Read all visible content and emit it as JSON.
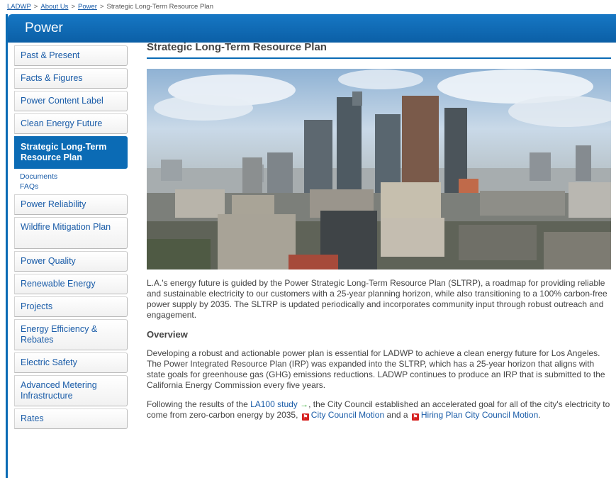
{
  "breadcrumb": {
    "items": [
      "LADWP",
      "About Us",
      "Power"
    ],
    "current": "Strategic Long-Term Resource Plan",
    "separator": ">"
  },
  "banner": {
    "title": "Power"
  },
  "sidebar": {
    "items": [
      "Past & Present",
      "Facts & Figures",
      "Power Content Label",
      "Clean Energy Future",
      "Strategic Long-Term Resource Plan",
      "Power Reliability",
      "Wildfire Mitigation Plan",
      "Power Quality",
      "Renewable Energy",
      "Projects",
      "Energy Efficiency & Rebates",
      "Electric Safety",
      "Advanced Metering Infrastructure",
      "Rates"
    ],
    "subitems": [
      "Documents",
      "FAQs"
    ]
  },
  "main": {
    "title": "Strategic Long-Term Resource Plan",
    "intro": "L.A.'s energy future is guided by the Power Strategic Long-Term Resource Plan (SLTRP), a roadmap for providing reliable and sustainable electricity to our customers with a 25-year planning horizon, while also transitioning to a 100% carbon-free power supply by 2035. The SLTRP is updated periodically and incorporates community input through robust outreach and engagement.",
    "overview_heading": "Overview",
    "overview": "Developing a robust and actionable power plan is essential for LADWP to achieve a clean energy future for Los Angeles. The Power Integrated Resource Plan (IRP) was expanded into the SLTRP, which has a 25-year horizon that aligns with state goals for greenhouse gas (GHG) emissions reductions. LADWP continues to produce an IRP that is submitted to the California Energy Commission every five years.",
    "p3": {
      "before": "Following the results of the ",
      "link1": "LA100 study",
      "middle": ", the City Council established an accelerated goal for all of the city's electricity to come from zero-carbon energy by 2035, ",
      "link2": "City Council Motion",
      "and": " and a ",
      "link3": "Hiring Plan City Council Motion",
      "end": "."
    }
  },
  "icons": {
    "external": "arrow-right-icon",
    "pdf": "pdf-icon"
  },
  "colors": {
    "brand": "#0b6bb5",
    "link": "#1a5ca8",
    "pdf": "#d6201f",
    "external_arrow": "#3cae3c"
  }
}
